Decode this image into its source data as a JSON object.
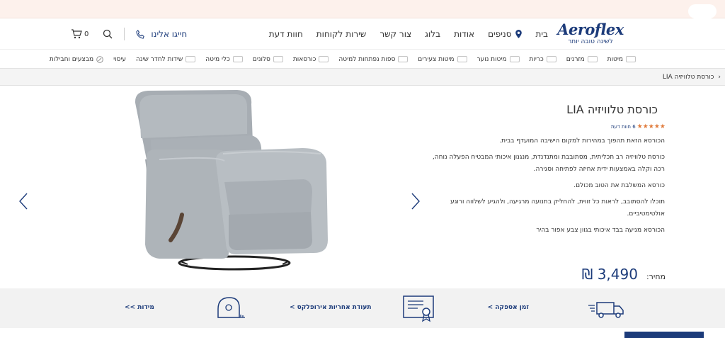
{
  "header": {
    "logo_text": "Aeroflex",
    "logo_tagline": "לשינה טובה יותר",
    "nav": [
      "בית",
      "סניפים",
      "אודות",
      "בלוג",
      "צור קשר",
      "שירות לקוחות",
      "חוות דעת"
    ],
    "phone_label": "חייגו אלינו",
    "cart_count": "0"
  },
  "categories": [
    "מיטות",
    "מזרנים",
    "כריות",
    "מיטות נוער",
    "מיטות צעירים",
    "ספות נפתחות למיטה",
    "כורסאות",
    "סלונים",
    "כלי מיטה",
    "שידות לחדר שינה",
    "עיסוי",
    "מבצעים וחבילות"
  ],
  "breadcrumb": {
    "separator": "‹",
    "current": "כורסת טלוויזיה LIA"
  },
  "product": {
    "title": "כורסת טלוויזיה LIA",
    "rating_stars": 5,
    "reviews": "6 חוות דעת",
    "description": [
      "הכורסא הזאת תהפוך במהירות למקום הישיבה המועדף בבית.",
      "כורסת טלוויזיה רב תכליתית, מסתובבת ומתנדנדת, מנגנון איכותי המבטיח הפעלה נוחה, רכה וקלה באמצעות ידית אחיזה לפתיחה וסגירה.",
      "כורסא המשלבת את הטוב מכולם.",
      "תוכלו להסתובב, לראות כל זווית, להחליק בתנועה מרגיעה, ולהגיע לשלווה ורוגע אולטימטיביים.",
      "הכורסא מגיעה בבד איכותי בגוון צבע אפור בהיר"
    ],
    "price_label": "מחיר:",
    "price": "3,490 ₪"
  },
  "features": [
    {
      "label": "זמן אספקה >",
      "icon": "delivery-truck-icon"
    },
    {
      "label": "תעודת אחריות אירופלקס >",
      "icon": "certificate-icon"
    },
    {
      "label": "מידות >>",
      "icon": "measuring-tape-icon"
    }
  ],
  "colors": {
    "brand": "#1c3b7a",
    "accent": "#e07a3a",
    "topbar": "#fdf1ec"
  }
}
